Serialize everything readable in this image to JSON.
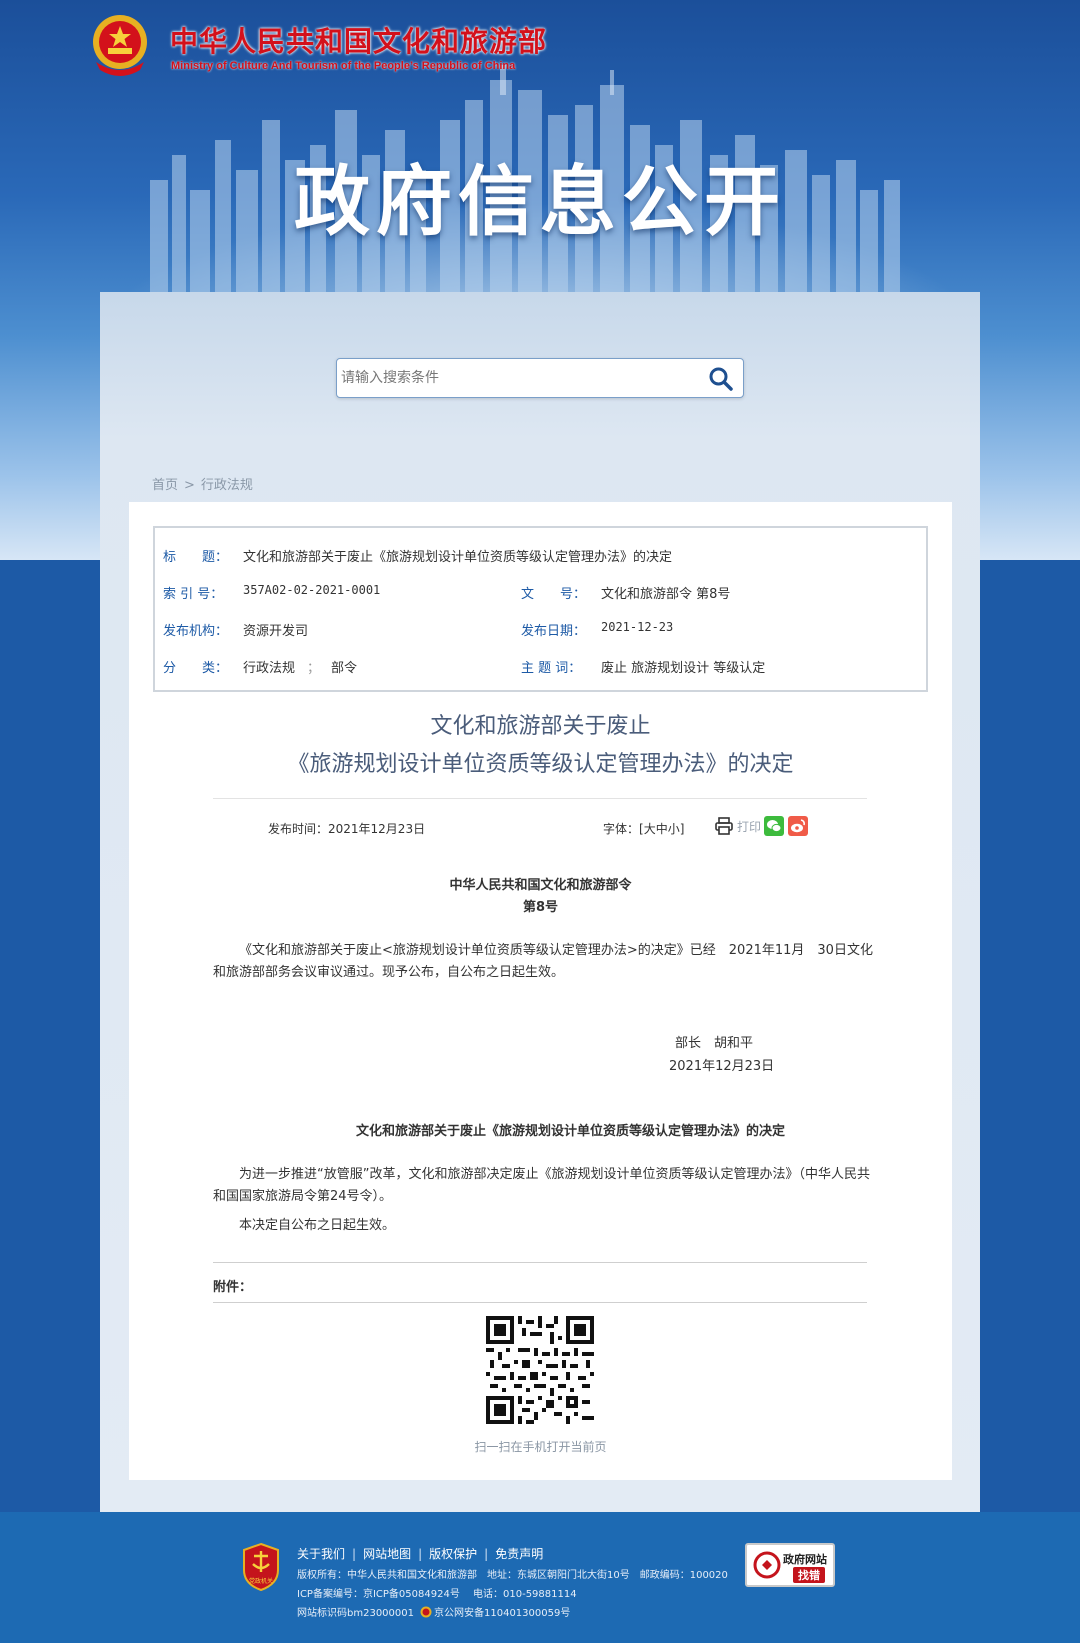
{
  "header": {
    "ministry_name_cn": "中华人民共和国文化和旅游部",
    "ministry_name_en": "Ministry of Culture And Tourism of the People’s Republic of China",
    "banner_title": "政府信息公开"
  },
  "search": {
    "placeholder": "请输入搜索条件"
  },
  "breadcrumb": {
    "home": "首页",
    "current": "行政法规",
    "separator": ">"
  },
  "meta": {
    "title_label": "标　　题：",
    "title_value": "文化和旅游部关于废止《旅游规划设计单位资质等级认定管理办法》的决定",
    "index_label": "索 引 号：",
    "index_value": "357A02-02-2021-0001",
    "docno_label": "文　　号：",
    "docno_value": "文化和旅游部令 第8号",
    "org_label": "发布机构：",
    "org_value": "资源开发司",
    "date_label": "发布日期：",
    "date_value": "2021-12-23",
    "category_label": "分　　类：",
    "category_value_1": "行政法规",
    "category_sep": "；",
    "category_value_2": "部令",
    "topic_label": "主 题 词：",
    "topic_value": "废止 旅游规划设计 等级认定"
  },
  "article": {
    "title_line1": "文化和旅游部关于废止",
    "title_line2": "《旅游规划设计单位资质等级认定管理办法》的决定",
    "publish_time": "发布时间：2021年12月23日",
    "font_size_label": "字体：[",
    "font_large": "大",
    "font_medium": "中",
    "font_small": "小",
    "font_size_close": "]",
    "print_label": "打印",
    "order_issuer": "中华人民共和国文化和旅游部令",
    "order_number": "第8号",
    "order_paragraph": "《文化和旅游部关于废止<旅游规划设计单位资质等级认定管理办法>的决定》已经　2021年11月　30日文化和旅游部部务会议审议通过。现予公布，自公布之日起生效。",
    "signer": "部长　胡和平",
    "sign_date": "2021年12月23日",
    "decision_title": "文化和旅游部关于废止《旅游规划设计单位资质等级认定管理办法》的决定",
    "decision_paragraph_1": "为进一步推进“放管服”改革，文化和旅游部决定废止《旅游规划设计单位资质等级认定管理办法》（中华人民共和国国家旅游局令第24号令）。",
    "decision_paragraph_2": "本决定自公布之日起生效。",
    "attachment_label": "附件：",
    "qr_caption": "扫一扫在手机打开当前页"
  },
  "footer": {
    "links": [
      "关于我们",
      "网站地图",
      "版权保护",
      "免责声明"
    ],
    "copyright": "版权所有：中华人民共和国文化和旅游部　地址：东城区朝阳门北大街10号　邮政编码：100020",
    "icp": "ICP备案编号：京ICP备05084924号　 电话：010-59881114",
    "site_id": "网站标识码bm23000001",
    "police_record": "京公网安备11040130005­9号",
    "emblem_caption": "党政机关",
    "gov_badge_line1": "政府网站",
    "gov_badge_line2": "找错"
  },
  "colors": {
    "brand_red": "#d3111b",
    "link_blue": "#1d5aa6",
    "footer_blue": "#1d6ab3"
  }
}
